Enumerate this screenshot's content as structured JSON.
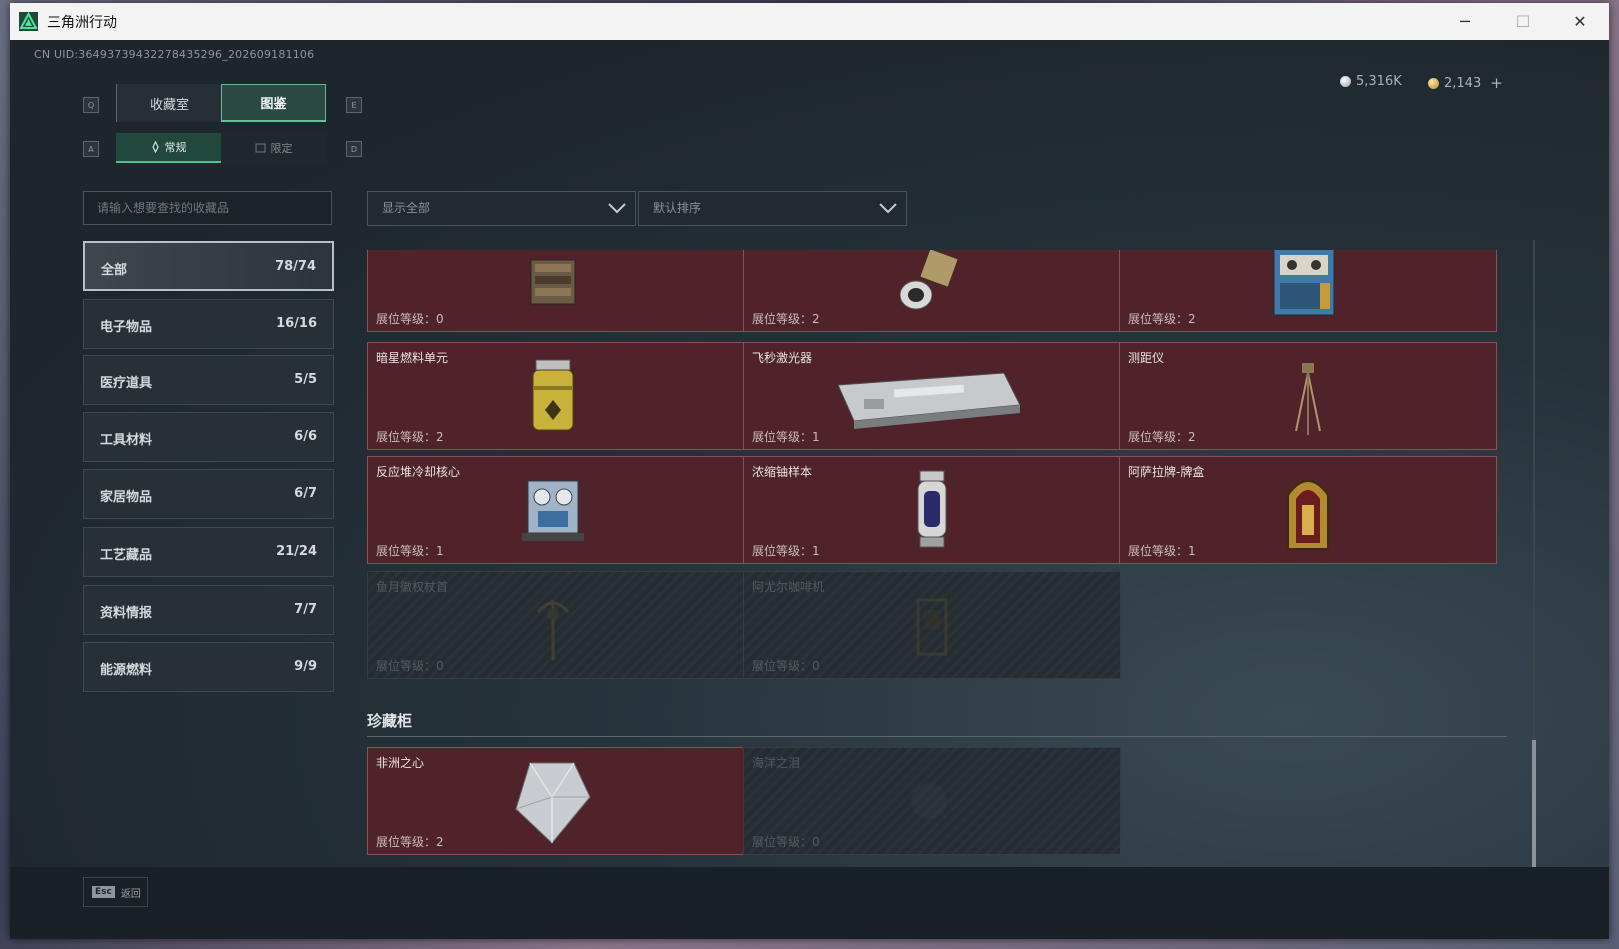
{
  "window": {
    "title": "三角洲行动",
    "minimize": "─",
    "maximize": "☐",
    "close": "✕"
  },
  "uid": "CN UID:36493739432278435296_202609181106",
  "currency": [
    {
      "value": "5,316K",
      "color": "#c9cdd0"
    },
    {
      "value": "2,143",
      "color": "#d7b66a"
    }
  ],
  "add_label": "+",
  "tabs": [
    {
      "label": "收藏室",
      "active": false
    },
    {
      "label": "图鉴",
      "active": true
    }
  ],
  "tab_keys": {
    "prev": "Q",
    "next": "E"
  },
  "subtabs": [
    {
      "label": "常规",
      "active": true
    },
    {
      "label": "限定",
      "active": false
    }
  ],
  "subtab_keys": {
    "prev": "A",
    "next": "D"
  },
  "search": {
    "placeholder": "请输入想要查找的收藏品"
  },
  "filters": {
    "display": "显示全部",
    "sort": "默认排序"
  },
  "categories": [
    {
      "label": "全部",
      "count": "78/74",
      "active": true
    },
    {
      "label": "电子物品",
      "count": "16/16"
    },
    {
      "label": "医疗道具",
      "count": "5/5"
    },
    {
      "label": "工具材料",
      "count": "6/6"
    },
    {
      "label": "家居物品",
      "count": "6/7"
    },
    {
      "label": "工艺藏品",
      "count": "21/24"
    },
    {
      "label": "资料情报",
      "count": "7/7"
    },
    {
      "label": "能源燃料",
      "count": "9/9"
    }
  ],
  "level_label": "展位等级：",
  "items": [
    {
      "name": "",
      "level": "0",
      "locked": false,
      "icon": "machine-icon"
    },
    {
      "name": "",
      "level": "2",
      "locked": false,
      "icon": "lens-device-icon"
    },
    {
      "name": "",
      "level": "2",
      "locked": false,
      "icon": "server-box-icon"
    },
    {
      "name": "暗星燃料单元",
      "level": "2",
      "locked": false,
      "icon": "fuel-canister-icon"
    },
    {
      "name": "飞秒激光器",
      "level": "1",
      "locked": false,
      "icon": "laser-device-icon"
    },
    {
      "name": "测距仪",
      "level": "2",
      "locked": false,
      "icon": "tripod-icon"
    },
    {
      "name": "反应堆冷却核心",
      "level": "1",
      "locked": false,
      "icon": "reactor-core-icon"
    },
    {
      "name": "浓缩铀样本",
      "level": "1",
      "locked": false,
      "icon": "uranium-capsule-icon"
    },
    {
      "name": "阿萨拉牌-牌盒",
      "level": "1",
      "locked": false,
      "icon": "card-box-icon"
    },
    {
      "name": "鱼月徽权杖首",
      "level": "0",
      "locked": true,
      "icon": "scepter-icon"
    },
    {
      "name": "阿尤尔咖啡机",
      "level": "0",
      "locked": true,
      "icon": "coffee-machine-icon"
    }
  ],
  "section": {
    "title": "珍藏柜"
  },
  "section_items": [
    {
      "name": "非洲之心",
      "level": "2",
      "locked": false,
      "icon": "diamond-icon"
    },
    {
      "name": "海洋之泪",
      "level": "0",
      "locked": true,
      "icon": "pearl-icon"
    }
  ],
  "footer": {
    "key": "Esc",
    "label": "返回"
  }
}
